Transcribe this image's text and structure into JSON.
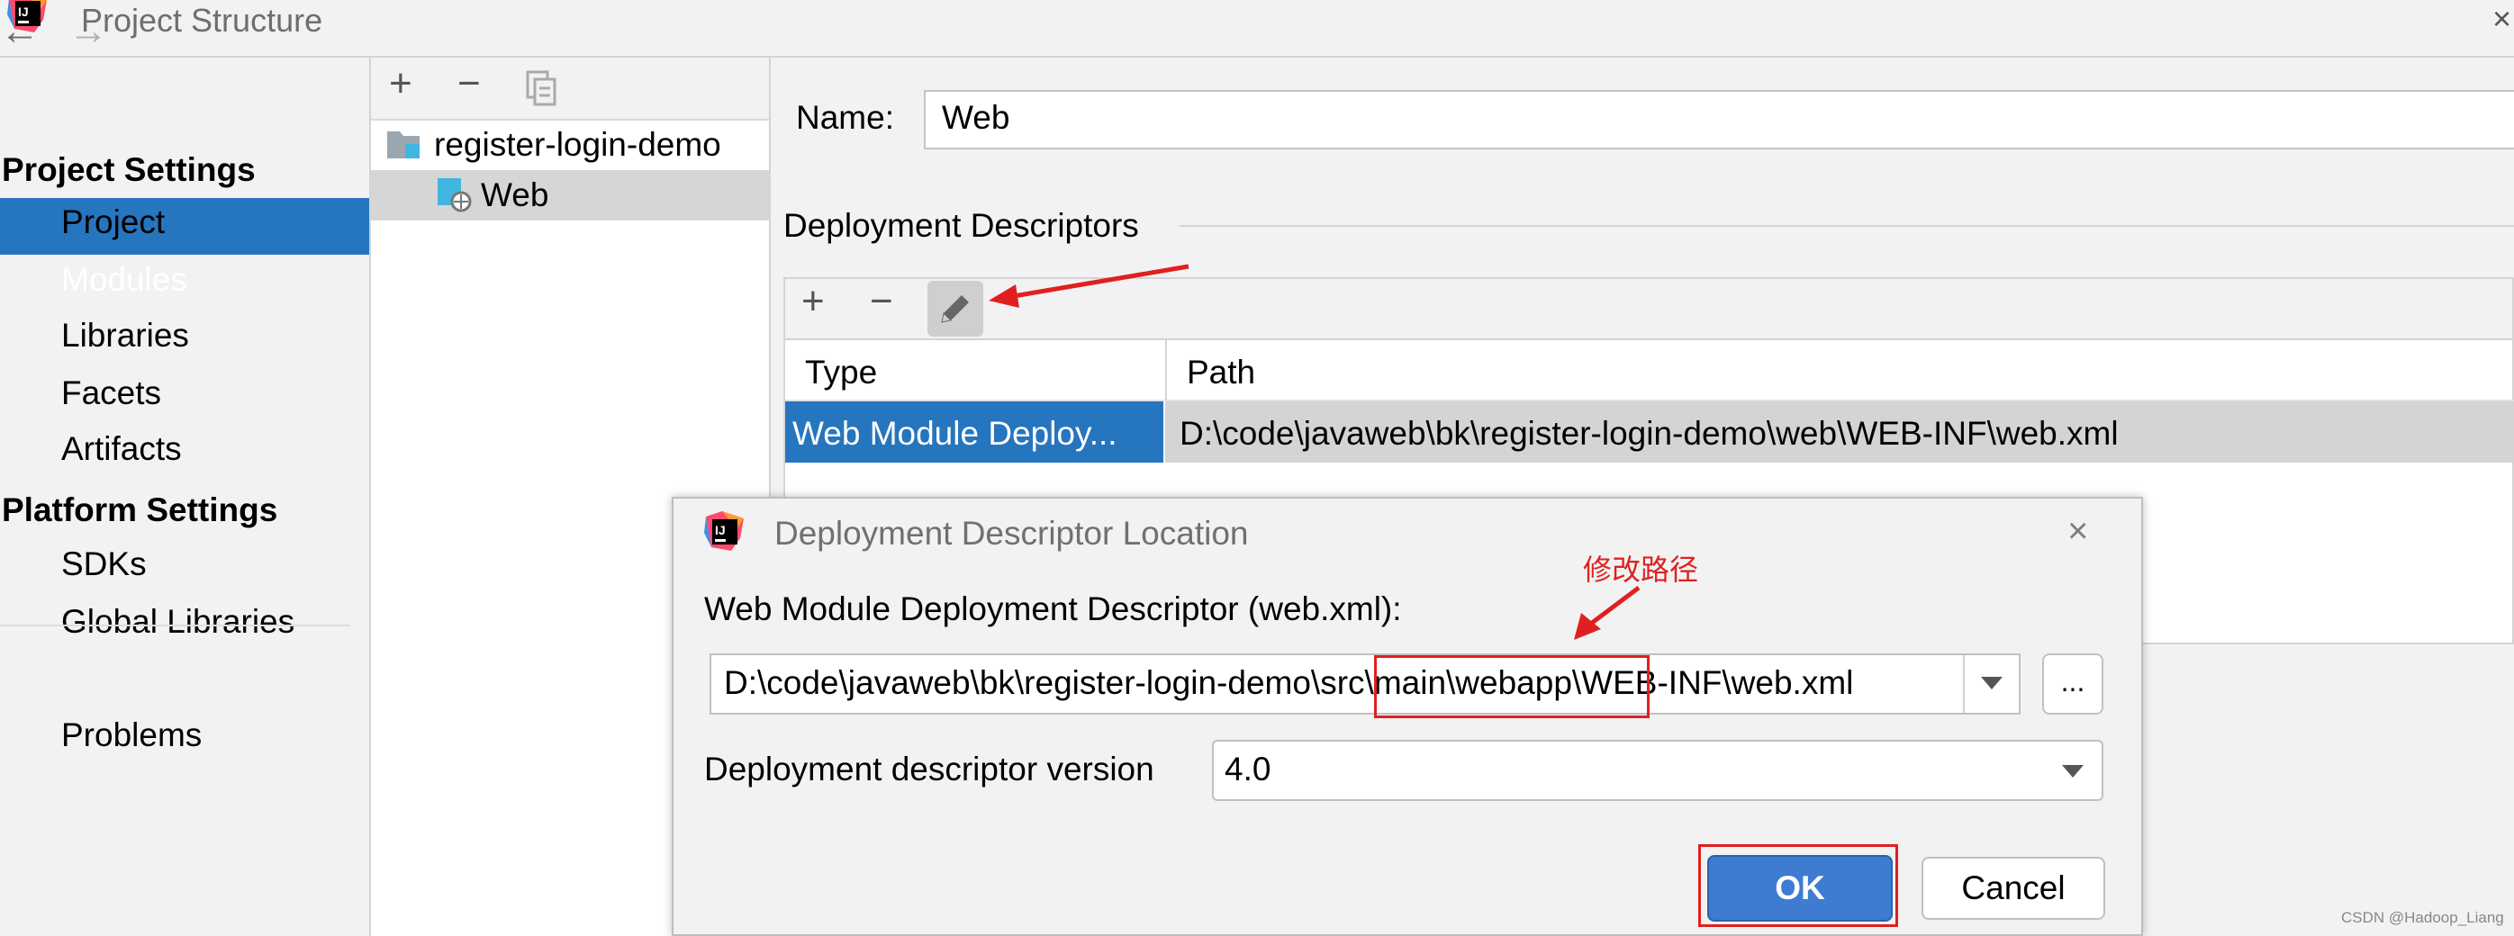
{
  "window": {
    "title": "Project Structure",
    "close_glyph": "×"
  },
  "nav": {
    "back_icon": "←",
    "forward_icon": "→",
    "project_settings": "Project Settings",
    "project_items": [
      "Project",
      "Modules",
      "Libraries",
      "Facets",
      "Artifacts"
    ],
    "selected": "Modules",
    "platform_settings": "Platform Settings",
    "platform_items": [
      "SDKs",
      "Global Libraries"
    ],
    "problems": "Problems"
  },
  "tree": {
    "toolbar": {
      "add": "+",
      "remove": "−"
    },
    "root": "register-login-demo",
    "child": "Web"
  },
  "module": {
    "name_label": "Name:",
    "name_value": "Web",
    "deployment_descriptors_heading": "Deployment Descriptors",
    "toolbar": {
      "add": "+",
      "remove": "−",
      "edit": "edit"
    },
    "table": {
      "columns": [
        "Type",
        "Path"
      ],
      "rows": [
        {
          "type": "Web Module Deploy...",
          "path": "D:\\code\\javaweb\\bk\\register-login-demo\\web\\WEB-INF\\web.xml"
        }
      ]
    }
  },
  "annotation": {
    "text": "修改路径",
    "color": "#e02020"
  },
  "dialog": {
    "title": "Deployment Descriptor Location",
    "close_glyph": "×",
    "label": "Web Module Deployment Descriptor (web.xml):",
    "path_value": "D:\\code\\javaweb\\bk\\register-login-demo\\src\\main\\webapp\\WEB-INF\\web.xml",
    "path_parts": {
      "prefix": "D:\\code\\javaweb\\bk\\register-login-demo\\",
      "highlight": "src\\main\\webapp",
      "suffix": "\\WEB-INF\\web.xml"
    },
    "browse_label": "...",
    "version_label": "Deployment descriptor version",
    "version_value": "4.0",
    "ok_label": "OK",
    "cancel_label": "Cancel"
  },
  "watermark": "CSDN @Hadoop_Liang",
  "colors": {
    "selection": "#2675bf",
    "ok_button": "#3d7cd0",
    "annotation_red": "#e02020"
  }
}
